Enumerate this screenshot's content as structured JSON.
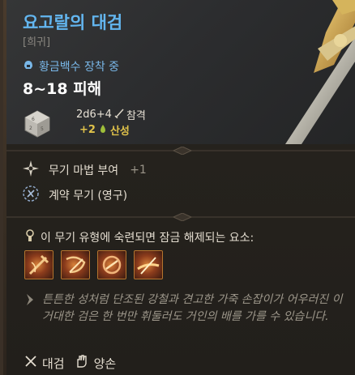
{
  "item": {
    "name": "요고랄의 대검",
    "rarity": "[희귀]",
    "equipped_text": "황금백수 장착 중",
    "damage": "8~18 피해",
    "dice_formula": "2d6+4",
    "damage_type": "참격",
    "bonus_value": "+2",
    "bonus_type": "산성"
  },
  "properties": [
    {
      "label": "무기 마법 부여",
      "plus": "+1"
    },
    {
      "label": "계약 무기 (영구)"
    }
  ],
  "proficiency": {
    "title": "이 무기 유형에 숙련되면 잠금 해제되는 요소:",
    "skill_icons": [
      "skill-icon-1",
      "skill-icon-2",
      "skill-icon-3",
      "skill-icon-4"
    ]
  },
  "flavor_text": "튼튼한 성처럼 단조된 강철과 견고한 가죽 손잡이가 어우러진 이 거대한 검은 한 번만 휘둘러도 거인의 배를 가를 수 있습니다.",
  "footer": {
    "weapon_type": "대검",
    "handedness": "양손"
  },
  "colors": {
    "title": "#63b6f0",
    "equipped": "#79b7e8",
    "bonus": "#e0c24a",
    "flavor": "#9c968a"
  }
}
